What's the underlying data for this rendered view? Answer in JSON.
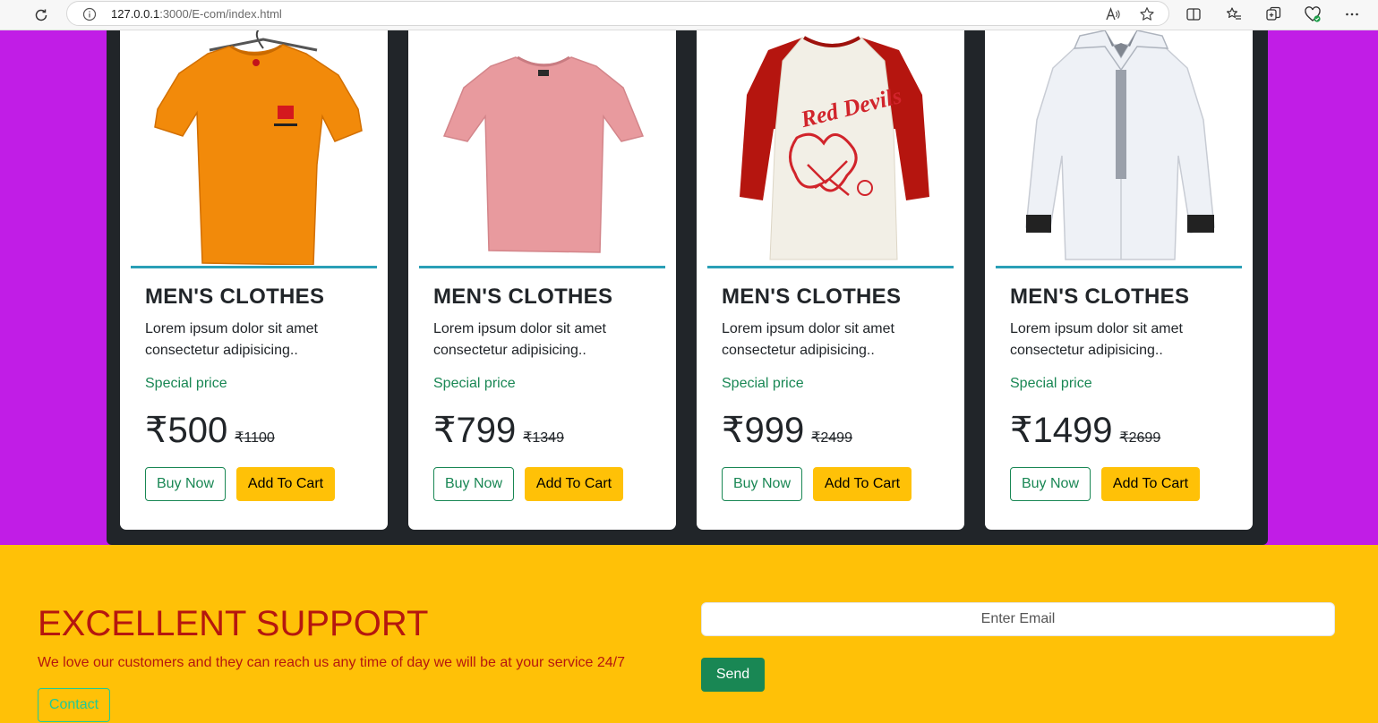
{
  "browser": {
    "url_host": "127.0.0.1",
    "url_rest": ":3000/E-com/index.html"
  },
  "products": [
    {
      "title": "MEN'S CLOTHES",
      "desc": "Lorem ipsum dolor sit amet consectetur adipisicing..",
      "special": "Special price",
      "price": "₹500",
      "old_price": "₹1100",
      "buy_label": "Buy Now",
      "cart_label": "Add To Cart"
    },
    {
      "title": "MEN'S CLOTHES",
      "desc": "Lorem ipsum dolor sit amet consectetur adipisicing..",
      "special": "Special price",
      "price": "₹799",
      "old_price": "₹1349",
      "buy_label": "Buy Now",
      "cart_label": "Add To Cart"
    },
    {
      "title": "MEN'S CLOTHES",
      "desc": "Lorem ipsum dolor sit amet consectetur adipisicing..",
      "special": "Special price",
      "price": "₹999",
      "old_price": "₹2499",
      "buy_label": "Buy Now",
      "cart_label": "Add To Cart"
    },
    {
      "title": "MEN'S CLOTHES",
      "desc": "Lorem ipsum dolor sit amet consectetur adipisicing..",
      "special": "Special price",
      "price": "₹1499",
      "old_price": "₹2699",
      "buy_label": "Buy Now",
      "cart_label": "Add To Cart"
    }
  ],
  "support": {
    "title": "EXCELLENT SUPPORT",
    "text": "We love our customers and they can reach us any time of day we will be at your service 24/7",
    "contact_label": "Contact",
    "email_placeholder": "Enter Email",
    "send_label": "Send"
  },
  "colors": {
    "purple_bg": "#c11de6",
    "dark_panel": "#212529",
    "yellow_bg": "#ffc107",
    "accent_green": "#198754",
    "accent_teal": "#2a9fb6",
    "support_red": "#b5170f"
  },
  "icons": [
    "reload-icon",
    "info-icon",
    "read-aloud-icon",
    "favorite-star-icon",
    "split-screen-icon",
    "favorites-list-icon",
    "collections-icon",
    "browser-essentials-icon",
    "more-menu-icon"
  ]
}
